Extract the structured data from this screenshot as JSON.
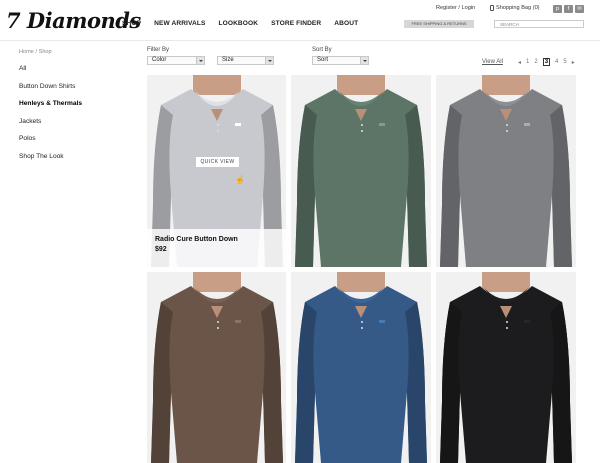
{
  "logo": "7 Diamonds",
  "nav": [
    "SHOP",
    "NEW ARRIVALS",
    "LOOKBOOK",
    "STORE FINDER",
    "ABOUT"
  ],
  "util": {
    "register": "Register / Login",
    "bag": "Shopping Bag (0)"
  },
  "social": [
    "p",
    "f",
    "✉"
  ],
  "shipping": "FREE SHIPPING & RETURNS",
  "search": {
    "placeholder": "SEARCH"
  },
  "breadcrumb": "Home / Shop",
  "sidebar": {
    "items": [
      {
        "label": "All"
      },
      {
        "label": "Button Down Shirts"
      },
      {
        "label": "Henleys & Thermals"
      },
      {
        "label": "Jackets"
      },
      {
        "label": "Polos"
      },
      {
        "label": "Shop The Look"
      }
    ]
  },
  "filters": {
    "filter_label": "Filter By",
    "color": "Color",
    "size": "Size",
    "sort_label": "Sort By",
    "sort": "Sort"
  },
  "pagination": {
    "view_all": "View All",
    "prev": "◂",
    "pages": [
      "1",
      "2",
      "3",
      "4",
      "5"
    ],
    "next": "▸"
  },
  "quick_view": "QUICK VIEW",
  "products": [
    {
      "name": "Radio Cure Button Down",
      "price": "$92",
      "color": "#c7c9cf"
    },
    {
      "color": "#5c7566"
    },
    {
      "color": "#7f8084"
    },
    {
      "color": "#6a5548"
    },
    {
      "color": "#355a88"
    },
    {
      "color": "#1c1c1e"
    }
  ]
}
